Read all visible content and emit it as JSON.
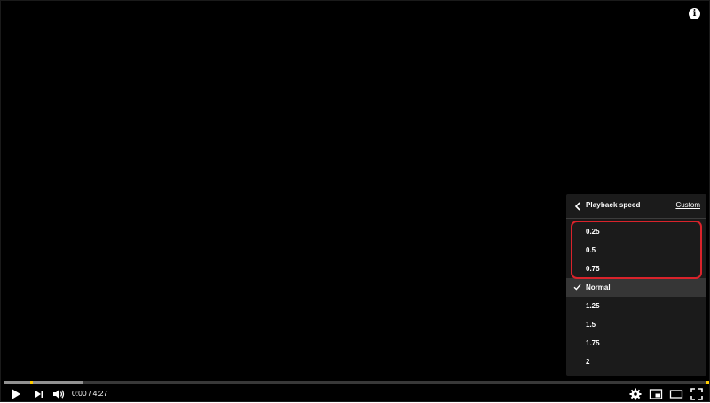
{
  "player": {
    "info_icon": "info-icon",
    "info_glyph": "i"
  },
  "settings_panel": {
    "title": "Playback speed",
    "custom_label": "Custom",
    "back_icon": "chevron-left-icon",
    "check_icon": "check-icon",
    "options": [
      {
        "label": "0.25",
        "selected": false
      },
      {
        "label": "0.5",
        "selected": false
      },
      {
        "label": "0.75",
        "selected": false
      },
      {
        "label": "Normal",
        "selected": true
      },
      {
        "label": "1.25",
        "selected": false
      },
      {
        "label": "1.5",
        "selected": false
      },
      {
        "label": "1.75",
        "selected": false
      },
      {
        "label": "2",
        "selected": false
      }
    ],
    "highlight_color": "#d9232b"
  },
  "progress": {
    "played_fraction": 0.0,
    "loaded_fraction": 0.112
  },
  "controls": {
    "time_display": "0:00 / 4:27",
    "icons": [
      "play-icon",
      "next-icon",
      "volume-icon",
      "settings-icon",
      "miniplayer-icon",
      "theater-icon",
      "fullscreen-icon"
    ]
  },
  "colors": {
    "background": "#000000",
    "accent": "#ff0000",
    "panel": "#1c1c1c"
  }
}
